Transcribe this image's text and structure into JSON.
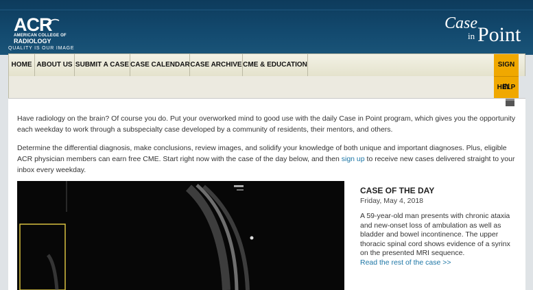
{
  "header": {
    "logo": {
      "main": "ACR",
      "sub1": "AMERICAN COLLEGE OF",
      "sub2": "RADIOLOGY"
    },
    "tagline": "QUALITY IS OUR IMAGE",
    "brand": {
      "case": "Case",
      "in": "in",
      "point": "Point"
    }
  },
  "nav": {
    "items": [
      "HOME",
      "ABOUT US",
      "SUBMIT A CASE",
      "CASE CALENDAR",
      "CASE ARCHIVE",
      "CME & EDUCATION"
    ],
    "sign_in": "SIGN IN",
    "help": "HELP"
  },
  "intro": {
    "p1": "Have radiology on the brain? Of course you do. Put your overworked mind to good use with the daily Case in Point program, which gives you the opportunity each weekday to work through a subspecialty case developed by a community of residents, their mentors, and others.",
    "p2_before": "Determine the differential diagnosis, make conclusions, review images, and solidify your knowledge of both unique and important diagnoses. Plus, eligible ACR physician members can earn free CME. Start right now with the case of the day below, and then ",
    "p2_link": "sign up",
    "p2_after": " to receive new cases delivered straight to your inbox every weekday."
  },
  "case_of_day": {
    "title": "CASE OF THE DAY",
    "date": "Friday, May 4, 2018",
    "description": "A 59-year-old man presents with chronic ataxia and new-onset loss of ambulation as well as bladder and bowel incontinence. The upper thoracic spinal cord shows evidence of a syrinx on the presented MRI sequence.",
    "link": "Read the rest of the case >>"
  },
  "colors": {
    "header_bg": "#134a6f",
    "nav_bg": "#f3f2e6",
    "accent": "#f0a800",
    "link": "#1b75a5"
  }
}
